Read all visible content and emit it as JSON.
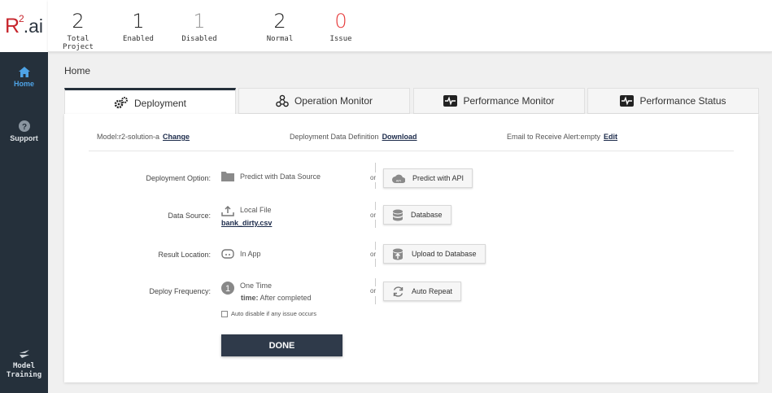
{
  "logo": {
    "brand": "R",
    "sup": "2",
    "suffix": ".ai"
  },
  "sidebar": {
    "home": "Home",
    "support": "Support",
    "training_line1": "Model",
    "training_line2": "Training"
  },
  "stats": [
    {
      "value": "2",
      "label": "Total Project"
    },
    {
      "value": "1",
      "label": "Enabled"
    },
    {
      "value": "1",
      "label": "Disabled"
    },
    {
      "value": "2",
      "label": "Normal"
    },
    {
      "value": "0",
      "label": "Issue"
    }
  ],
  "breadcrumb": "Home",
  "tabs": [
    {
      "label": "Deployment",
      "icon": "gears-icon"
    },
    {
      "label": "Operation Monitor",
      "icon": "network-icon"
    },
    {
      "label": "Performance Monitor",
      "icon": "pulse-icon"
    },
    {
      "label": "Performance Status",
      "icon": "pulse-icon"
    }
  ],
  "info": {
    "model_text": "Model:r2-solution-a",
    "model_link": "Change",
    "definition_text": "Deployment Data Definition",
    "definition_link": "Download",
    "email_text": "Email to Receive Alert:empty",
    "email_link": "Edit"
  },
  "form": {
    "deployment_option_label": "Deployment Option:",
    "deployment_option_value": "Predict with Data Source",
    "deployment_option_alt": "Predict with API",
    "data_source_label": "Data Source:",
    "data_source_value": "Local File",
    "data_source_file": "bank_dirty.csv",
    "data_source_alt": "Database",
    "result_location_label": "Result Location:",
    "result_location_value": "In App",
    "result_location_alt": "Upload to Database",
    "deploy_frequency_label": "Deploy Frequency:",
    "deploy_frequency_value": "One Time",
    "deploy_frequency_time_label": "time:",
    "deploy_frequency_time_value": "After completed",
    "deploy_frequency_alt": "Auto Repeat",
    "frequency_badge": "1",
    "or_text": "or",
    "auto_disable": "Auto disable if any issue occurs",
    "done": "DONE"
  },
  "colors": {
    "sidebar": "#25303b",
    "accent": "#4ea3e6",
    "issue": "#e63a3a",
    "brand": "#c7252c"
  }
}
